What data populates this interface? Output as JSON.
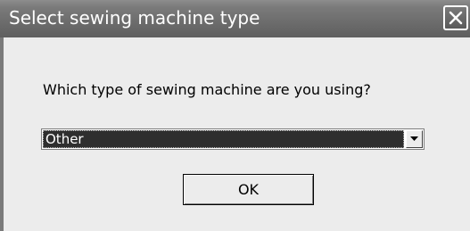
{
  "window": {
    "title": "Select sewing machine type"
  },
  "dialog": {
    "prompt": "Which type of sewing machine are you using?",
    "machine_type": {
      "selected": "Other"
    },
    "ok_label": "OK"
  },
  "icons": {
    "close": "close-icon",
    "dropdown": "chevron-down-icon"
  }
}
